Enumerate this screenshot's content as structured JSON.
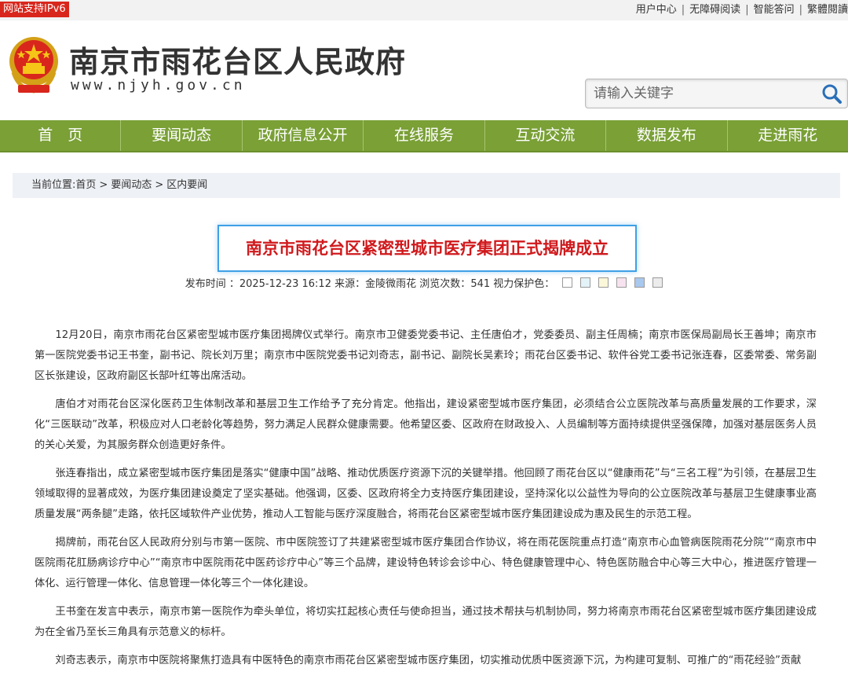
{
  "topbar": {
    "ipv6_badge": "网站支持IPv6",
    "links": [
      "用户中心",
      "无障碍阅读",
      "智能答问",
      "繁體閱讀"
    ]
  },
  "header": {
    "site_title": "南京市雨花台区人民政府",
    "site_url": "www.njyh.gov.cn",
    "search_placeholder": "请输入关键字"
  },
  "nav": {
    "items": [
      "首　页",
      "要闻动态",
      "政府信息公开",
      "在线服务",
      "互动交流",
      "数据发布",
      "走进雨花"
    ]
  },
  "breadcrumb": {
    "prefix": "当前位置:",
    "items": [
      "首页",
      "要闻动态",
      "区内要闻"
    ]
  },
  "article": {
    "title": "南京市雨花台区紧密型城市医疗集团正式揭牌成立",
    "meta": {
      "publish_label": "发布时间 ：",
      "publish_time": "2025-12-23 16:12",
      "source_label": "来源：",
      "source": "金陵微雨花",
      "views_label": "浏览次数：",
      "views": "541",
      "eye_label": "视力保护色："
    },
    "eye_colors": [
      "#ffffff",
      "#e3f3f8",
      "#fbf7d9",
      "#f7e3f0",
      "#a9c8ee",
      "#ececec"
    ],
    "paragraphs": [
      "12月20日，南京市雨花台区紧密型城市医疗集团揭牌仪式举行。南京市卫健委党委书记、主任唐伯才，党委委员、副主任周楠；南京市医保局副局长王善坤；南京市第一医院党委书记王书奎，副书记、院长刘万里；南京市中医院党委书记刘奇志，副书记、副院长吴素玲；雨花台区委书记、软件谷党工委书记张连春，区委常委、常务副区长张建设，区政府副区长郜叶红等出席活动。",
      "唐伯才对雨花台区深化医药卫生体制改革和基层卫生工作给予了充分肯定。他指出，建设紧密型城市医疗集团，必须结合公立医院改革与高质量发展的工作要求，深化“三医联动”改革，积极应对人口老龄化等趋势，努力满足人民群众健康需要。他希望区委、区政府在财政投入、人员编制等方面持续提供坚强保障，加强对基层医务人员的关心关爱，为其服务群众创造更好条件。",
      "张连春指出，成立紧密型城市医疗集团是落实“健康中国”战略、推动优质医疗资源下沉的关键举措。他回顾了雨花台区以“健康雨花”与“三名工程”为引领，在基层卫生领域取得的显著成效，为医疗集团建设奠定了坚实基础。他强调，区委、区政府将全力支持医疗集团建设，坚持深化以公益性为导向的公立医院改革与基层卫生健康事业高质量发展“两条腿”走路，依托区域软件产业优势，推动人工智能与医疗深度融合，将雨花台区紧密型城市医疗集团建设成为惠及民生的示范工程。",
      "揭牌前，雨花台区人民政府分别与市第一医院、市中医院签订了共建紧密型城市医疗集团合作协议，将在雨花医院重点打造“南京市心血管病医院雨花分院”“南京市中医院雨花肛肠病诊疗中心”“南京市中医院雨花中医药诊疗中心”等三个品牌，建设特色转诊会诊中心、特色健康管理中心、特色医防融合中心等三大中心，推进医疗管理一体化、运行管理一体化、信息管理一体化等三个一体化建设。",
      "王书奎在发言中表示，南京市第一医院作为牵头单位，将切实扛起核心责任与使命担当，通过技术帮扶与机制协同，努力将南京市雨花台区紧密型城市医疗集团建设成为在全省乃至长三角具有示范意义的标杆。",
      "刘奇志表示，南京市中医院将聚焦打造具有中医特色的南京市雨花台区紧密型城市医疗集团，切实推动优质中医资源下沉，为构建可复制、可推广的“雨花经验”贡献"
    ]
  }
}
